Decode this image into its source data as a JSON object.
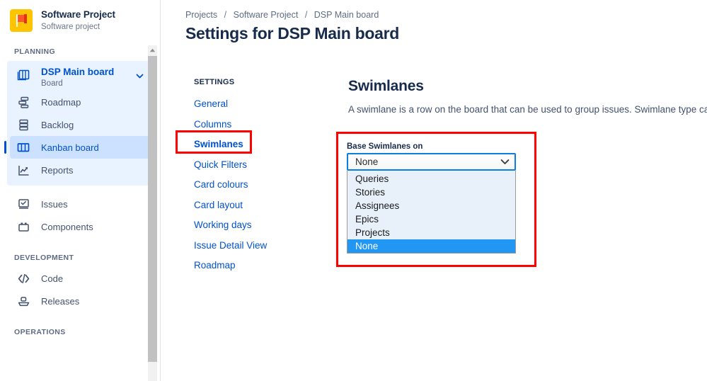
{
  "sidebar": {
    "project": {
      "name": "Software Project",
      "type": "Software project",
      "avatar_icon": "flag-icon",
      "avatar_color": "#ffc400"
    },
    "sections": [
      {
        "label": "PLANNING",
        "board": {
          "title": "DSP Main board",
          "subtitle": "Board",
          "icon": "board-icon",
          "chevron_icon": "chevron-down-icon",
          "items": [
            {
              "label": "Roadmap",
              "icon": "roadmap-icon",
              "selected": false
            },
            {
              "label": "Backlog",
              "icon": "backlog-icon",
              "selected": false
            },
            {
              "label": "Kanban board",
              "icon": "kanban-board-icon",
              "selected": true
            },
            {
              "label": "Reports",
              "icon": "reports-icon",
              "selected": false
            }
          ]
        },
        "items": [
          {
            "label": "Issues",
            "icon": "issues-icon"
          },
          {
            "label": "Components",
            "icon": "components-icon"
          }
        ]
      },
      {
        "label": "DEVELOPMENT",
        "items": [
          {
            "label": "Code",
            "icon": "code-icon"
          },
          {
            "label": "Releases",
            "icon": "releases-icon"
          }
        ]
      },
      {
        "label": "OPERATIONS",
        "items": []
      }
    ],
    "scrollbar": {
      "up_arrow_icon": "scroll-up-arrow-icon"
    }
  },
  "main": {
    "breadcrumb": [
      "Projects",
      "Software Project",
      "DSP Main board"
    ],
    "breadcrumb_separator": "/",
    "page_title": "Settings for DSP Main board",
    "settings_nav": {
      "heading": "SETTINGS",
      "items": [
        {
          "label": "General",
          "active": false
        },
        {
          "label": "Columns",
          "active": false
        },
        {
          "label": "Swimlanes",
          "active": true
        },
        {
          "label": "Quick Filters",
          "active": false
        },
        {
          "label": "Card colours",
          "active": false
        },
        {
          "label": "Card layout",
          "active": false
        },
        {
          "label": "Working days",
          "active": false
        },
        {
          "label": "Issue Detail View",
          "active": false
        },
        {
          "label": "Roadmap",
          "active": false
        }
      ]
    },
    "content": {
      "title": "Swimlanes",
      "description": "A swimlane is a row on the board that can be used to group issues. Swimlane type can b"
    },
    "field": {
      "label": "Base Swimlanes on",
      "selected_value": "None",
      "caret_icon": "chevron-down-icon",
      "options": [
        {
          "label": "Queries",
          "highlighted": false
        },
        {
          "label": "Stories",
          "highlighted": false
        },
        {
          "label": "Assignees",
          "highlighted": false
        },
        {
          "label": "Epics",
          "highlighted": false
        },
        {
          "label": "Projects",
          "highlighted": false
        },
        {
          "label": "None",
          "highlighted": true
        }
      ]
    }
  },
  "annotations": {
    "highlight_color": "#ff0000",
    "boxes": [
      "swimlanes-settings-link",
      "base-swimlanes-on-dropdown"
    ]
  },
  "colors": {
    "accent_blue": "#0052cc",
    "selected_nav_bg": "#cce0ff",
    "board_group_bg": "#e9f2ff",
    "option_highlight": "#2196f3",
    "dropdown_bg": "#e8f1fa",
    "focus_border": "#0b7fe0"
  }
}
